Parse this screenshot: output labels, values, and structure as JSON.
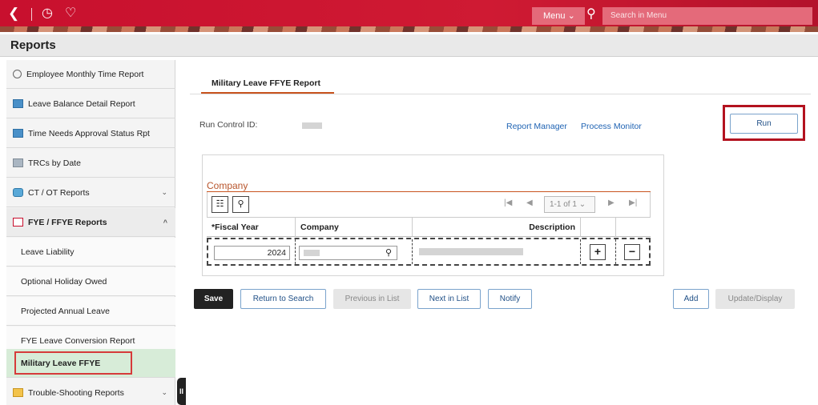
{
  "topbar": {
    "back_icon": "chevron-left-icon",
    "recent_icon": "clock-icon",
    "favorites_icon": "heart-icon",
    "menu_label": "Menu ⌄",
    "search_placeholder": "Search in Menu"
  },
  "page": {
    "title": "Reports"
  },
  "sidebar": {
    "items": [
      {
        "label": "Employee Monthly Time Report",
        "icon": "clock-icon"
      },
      {
        "label": "Leave Balance Detail Report",
        "icon": "report-icon"
      },
      {
        "label": "Time Needs Approval Status Rpt",
        "icon": "report-icon"
      },
      {
        "label": "TRCs by Date",
        "icon": "report-icon"
      },
      {
        "label": "CT / OT Reports",
        "icon": "folder-icon",
        "chevron": "⌄"
      },
      {
        "label": "FYE / FFYE Reports",
        "icon": "folder-open-icon",
        "chevron": "^"
      },
      {
        "label": "Leave Liability"
      },
      {
        "label": "Optional Holiday Owed"
      },
      {
        "label": "Projected Annual Leave"
      },
      {
        "label": "FYE Leave Conversion Report"
      },
      {
        "label": "Military Leave FFYE",
        "active": true
      },
      {
        "label": "Trouble-Shooting Reports",
        "icon": "folder-icon",
        "chevron": "⌄"
      }
    ],
    "collapse_handle": "II"
  },
  "main": {
    "tab_label": "Military Leave FFYE Report",
    "run_control_label": "Run Control ID:",
    "links": {
      "report_manager": "Report Manager",
      "process_monitor": "Process Monitor"
    },
    "run_label": "Run",
    "grid": {
      "title": "Company",
      "pager_text": "1-1 of 1 ⌄",
      "columns": [
        "*Fiscal Year",
        "Company",
        "Description"
      ],
      "row": {
        "fiscal_year": "2024"
      },
      "add_row": "+",
      "delete_row": "−"
    },
    "buttons": {
      "save": "Save",
      "return_to_search": "Return to Search",
      "previous_in_list": "Previous in List",
      "next_in_list": "Next in List",
      "notify": "Notify",
      "add": "Add",
      "update_display": "Update/Display"
    }
  },
  "colors": {
    "brand": "#c8102e",
    "link": "#1f63b3",
    "highlight": "#d63a3a",
    "active_bg": "#d7ecd8"
  }
}
